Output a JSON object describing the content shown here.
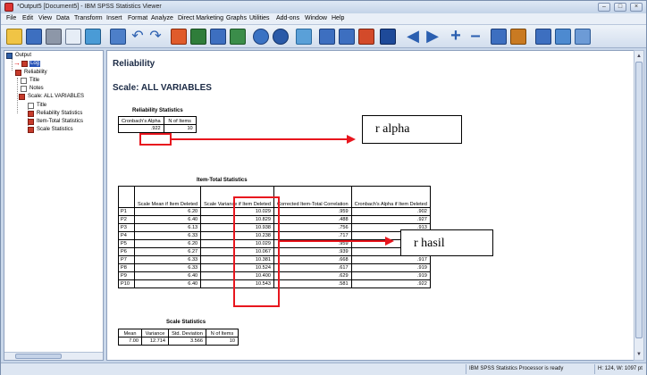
{
  "window": {
    "title": "*Output5 [Document5] - IBM SPSS Statistics Viewer",
    "controls": [
      "–",
      "□",
      "×"
    ]
  },
  "menubar": [
    "File",
    "Edit",
    "View",
    "Data",
    "Transform",
    "Insert",
    "Format",
    "Analyze",
    "Direct Marketing",
    "Graphs",
    "Utilities",
    "Add-ons",
    "Window",
    "Help"
  ],
  "toolbar": {
    "icons": [
      "open-icon",
      "save-icon",
      "print-icon",
      "print-preview-icon",
      "export-icon",
      "recall-dialog-icon",
      "undo-icon",
      "redo-icon",
      "goto-data-icon",
      "goto-case-icon",
      "variables-icon",
      "split-file-icon",
      "weight-icon",
      "select-cases-icon",
      "value-labels-icon",
      "designate-window-icon",
      "show-all-icon",
      "insert-heading-icon",
      "insert-title-icon",
      "insert-text-icon",
      "back-icon",
      "forward-icon",
      "expand-icon",
      "collapse-icon",
      "show-icon",
      "hide-icon",
      "outline-icon",
      "script-icon",
      "custom-dialog-icon"
    ]
  },
  "navigator": {
    "nodes": [
      {
        "label": "Output",
        "icon": "output-book-icon"
      },
      {
        "label": "Log",
        "icon": "log-icon",
        "selected": true
      },
      {
        "label": "Reliability",
        "icon": "reliability-icon"
      },
      {
        "label": "Title",
        "icon": "title-icon"
      },
      {
        "label": "Notes",
        "icon": "notes-icon"
      },
      {
        "label": "Scale: ALL VARIABLES",
        "icon": "scale-icon"
      },
      {
        "label": "Title",
        "icon": "title-icon"
      },
      {
        "label": "Reliability Statistics",
        "icon": "table-icon"
      },
      {
        "label": "Item-Total Statistics",
        "icon": "table-icon"
      },
      {
        "label": "Scale Statistics",
        "icon": "table-icon"
      }
    ]
  },
  "content": {
    "heading": "Reliability",
    "subheading": "Scale: ALL VARIABLES",
    "reliability_statistics": {
      "caption": "Reliability Statistics",
      "headers": [
        "Cronbach's Alpha",
        "N of Items"
      ],
      "values": [
        ".922",
        "10"
      ]
    },
    "item_total_statistics": {
      "caption": "Item-Total Statistics",
      "headers": [
        "",
        "Scale Mean if Item Deleted",
        "Scale Variance if Item Deleted",
        "Corrected Item-Total Correlation",
        "Cronbach's Alpha if Item Deleted"
      ],
      "rows": [
        [
          "P1",
          "6.20",
          "10.029",
          ".959",
          ".902"
        ],
        [
          "P2",
          "6.40",
          "10.829",
          ".488",
          ".927"
        ],
        [
          "P3",
          "6.13",
          "10.938",
          ".756",
          ".913"
        ],
        [
          "P4",
          "6.33",
          "10.238",
          ".717",
          ".914"
        ],
        [
          "P5",
          "6.20",
          "10.029",
          ".959",
          ".902"
        ],
        [
          "P6",
          "6.27",
          "10.067",
          ".939",
          ".907"
        ],
        [
          "P7",
          "6.33",
          "10.381",
          ".668",
          ".917"
        ],
        [
          "P8",
          "6.33",
          "10.524",
          ".617",
          ".919"
        ],
        [
          "P9",
          "6.40",
          "10.400",
          ".629",
          ".919"
        ],
        [
          "P10",
          "6.40",
          "10.543",
          ".581",
          ".922"
        ]
      ]
    },
    "scale_statistics": {
      "caption": "Scale Statistics",
      "headers": [
        "Mean",
        "Variance",
        "Std. Deviation",
        "N of Items"
      ],
      "values": [
        "7.00",
        "12.714",
        "3.566",
        "10"
      ]
    }
  },
  "annotations": {
    "alpha_label": "r alpha",
    "hasil_label": "r hasil",
    "color": "#e8161e"
  },
  "statusbar": {
    "processor": "IBM SPSS Statistics Processor is ready",
    "dimensions": "H: 124, W: 1097 pt"
  }
}
